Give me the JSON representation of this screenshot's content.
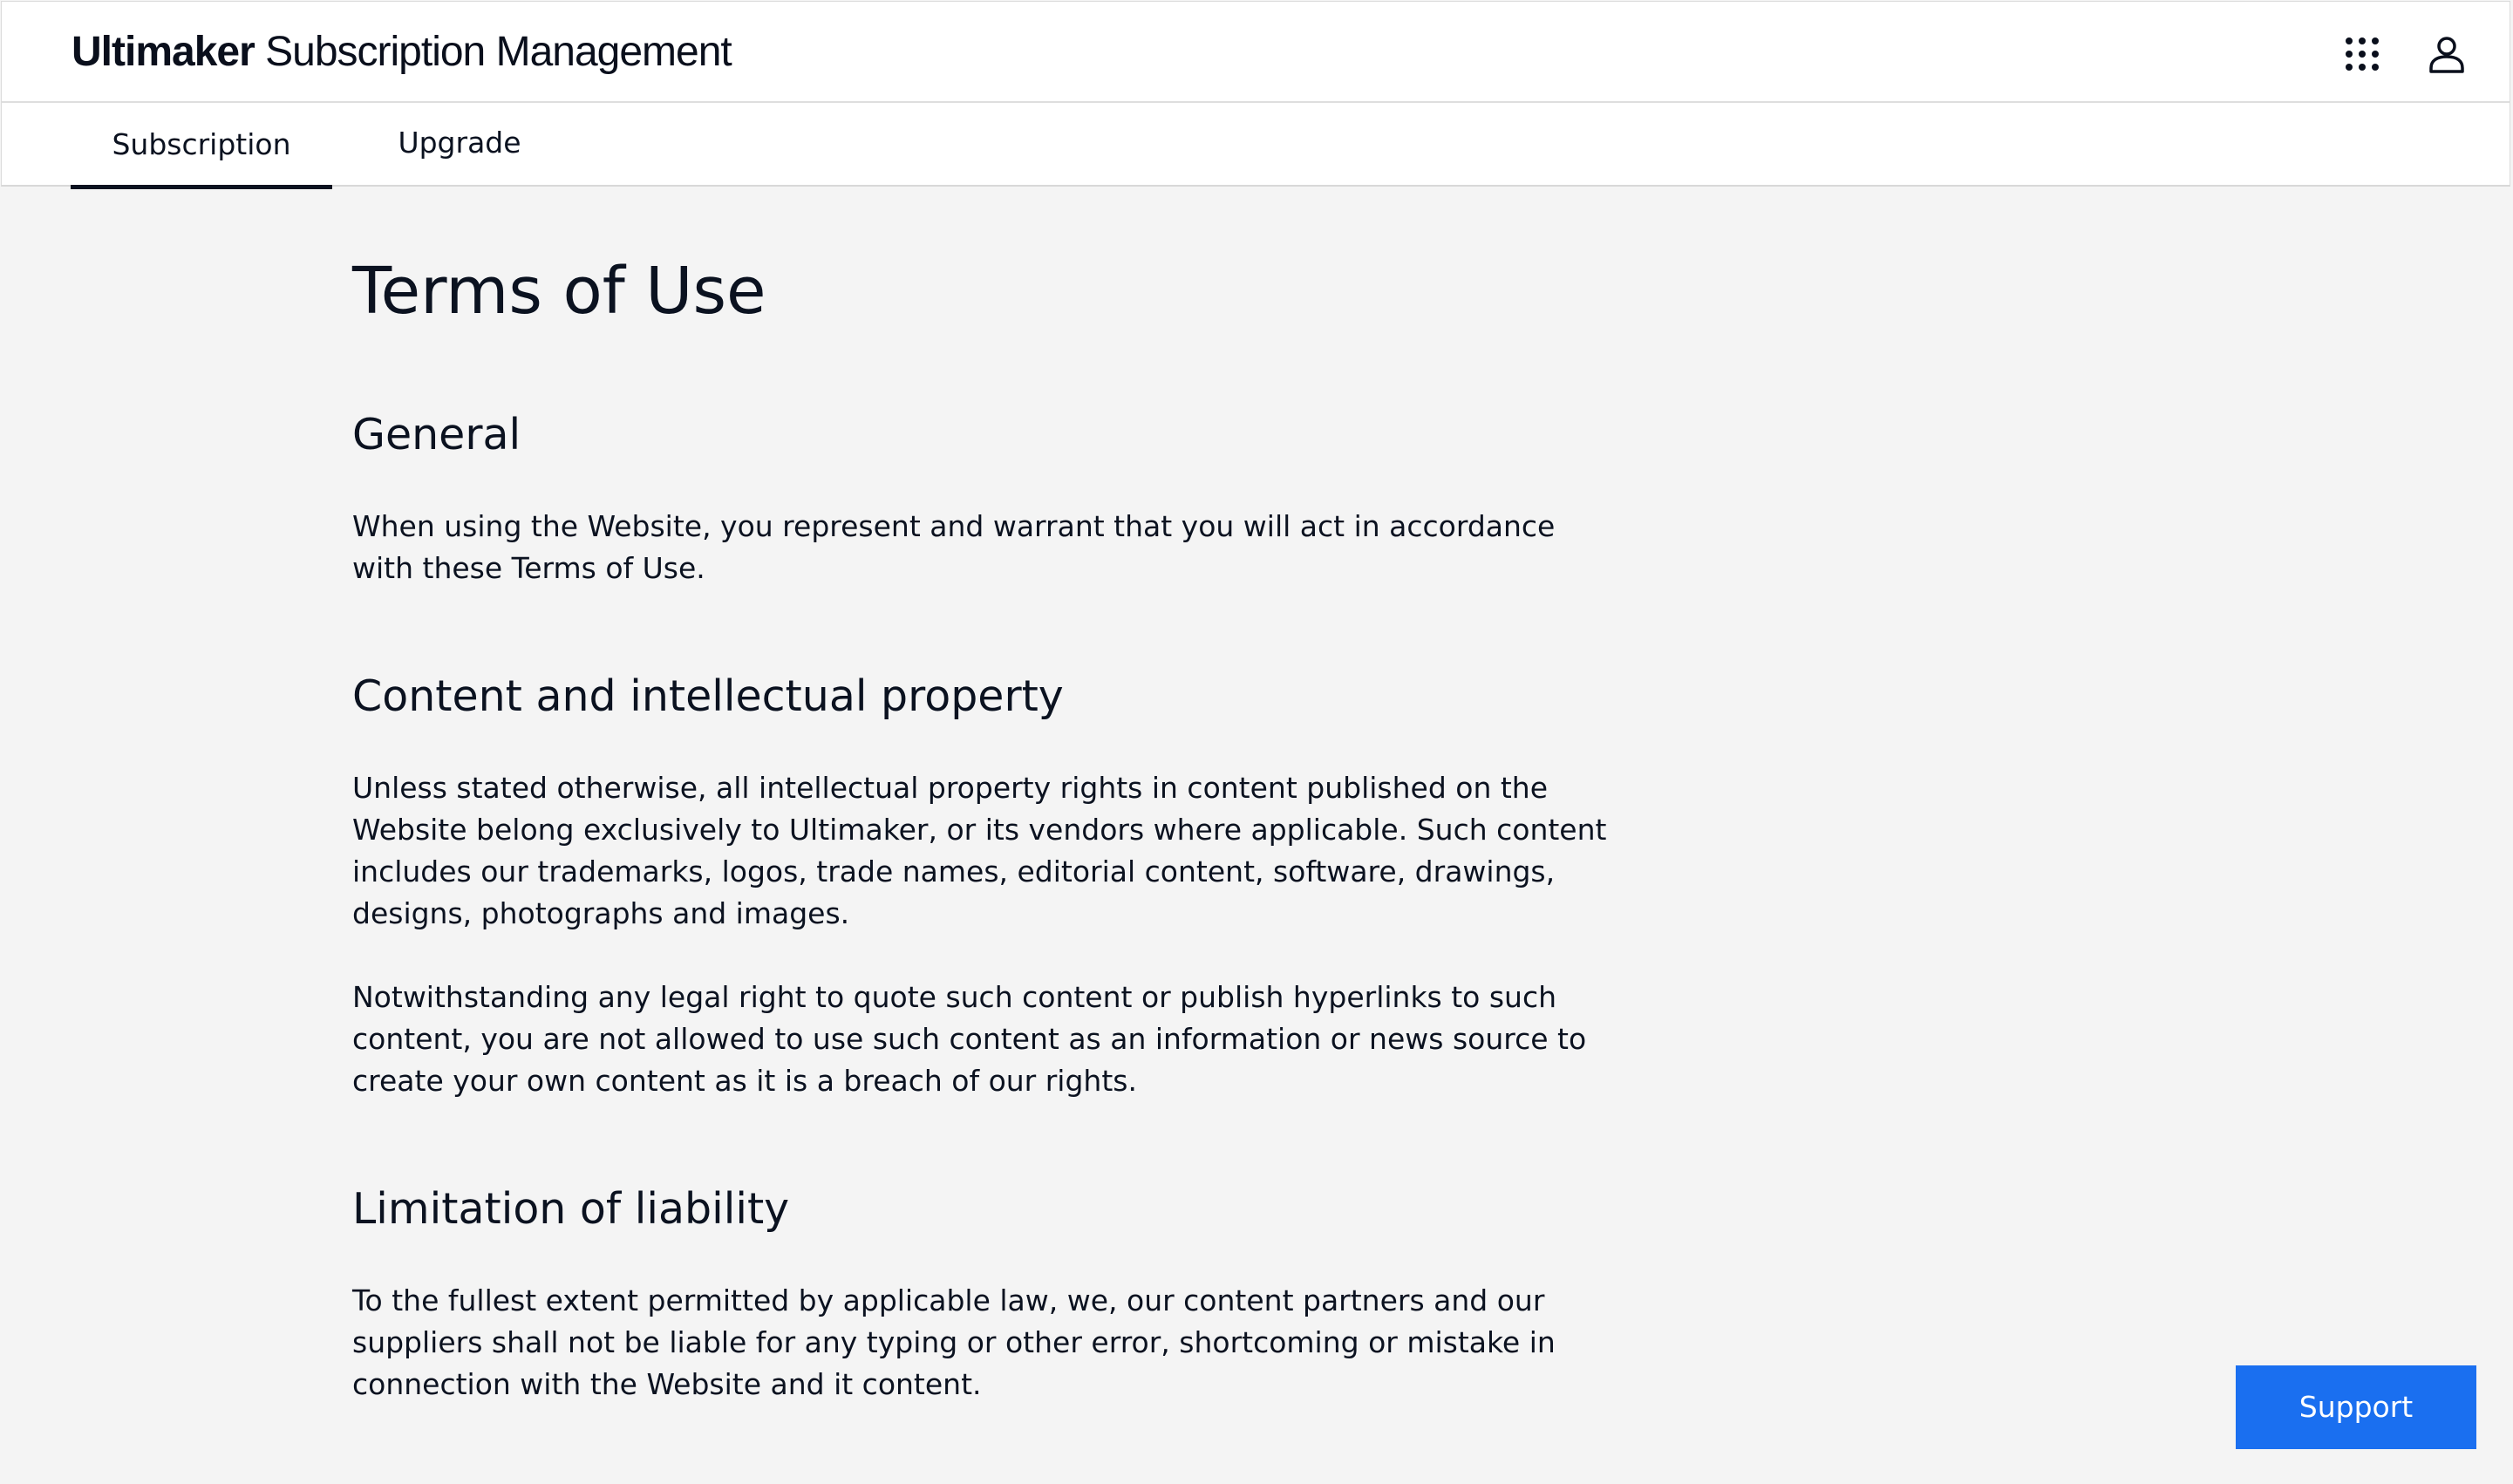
{
  "header": {
    "brand_bold": "Ultimaker",
    "brand_regular": " Subscription Management",
    "apps_icon": "apps-grid-icon",
    "user_icon": "user-account-icon"
  },
  "tabs": [
    {
      "label": "Subscription",
      "active": true
    },
    {
      "label": "Upgrade",
      "active": false
    }
  ],
  "main": {
    "title": "Terms of Use",
    "sections": [
      {
        "heading": "General",
        "paragraphs": [
          "When using the Website, you represent and warrant that you will act in accordance with these Terms of Use."
        ]
      },
      {
        "heading": "Content and intellectual property",
        "paragraphs": [
          "Unless stated otherwise, all intellectual property rights in content published on the Website belong exclusively to Ultimaker, or its vendors where applicable. Such content includes our trademarks, logos, trade names, editorial content, software, drawings, designs, photographs and images.",
          "Notwithstanding any legal right to quote such content or publish hyperlinks to such content, you are not allowed to use such content as an information or news source to create your own content as it is a breach of our rights."
        ]
      },
      {
        "heading": "Limitation of liability",
        "paragraphs": [
          "To the fullest extent permitted by applicable law, we, our content partners and our suppliers shall not be liable for any typing or other error, shortcoming or mistake in connection with the Website and it content."
        ]
      }
    ]
  },
  "support_button": {
    "label": "Support"
  },
  "colors": {
    "accent": "#1a6ff0",
    "background": "#f4f4f4",
    "text": "#0b1220"
  }
}
